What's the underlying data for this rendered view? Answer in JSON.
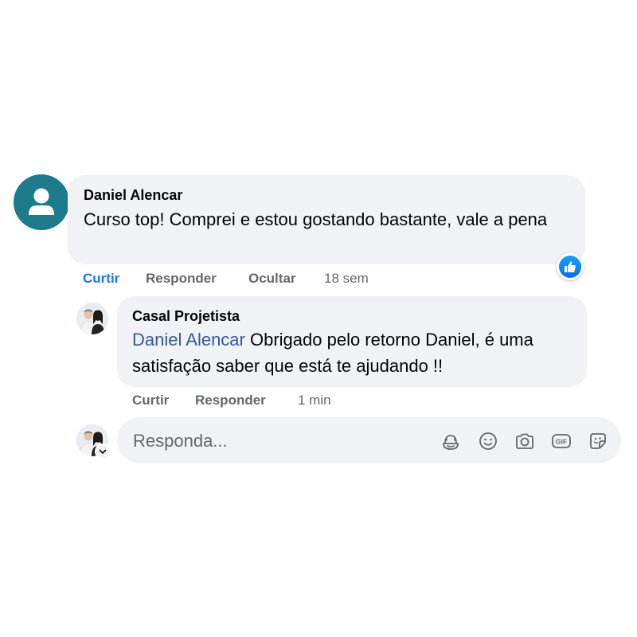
{
  "comments": [
    {
      "author": "Daniel Alencar",
      "text": "Curso top! Comprei e estou gostando bastante, vale a pena",
      "actions": {
        "like": "Curtir",
        "reply": "Responder",
        "hide": "Ocultar",
        "time": "18 sem"
      },
      "reaction": "like-icon"
    },
    {
      "author": "Casal Projetista",
      "mention": "Daniel Alencar",
      "text": " Obrigado pelo retorno Daniel, é uma satisfação saber que está te ajudando !!",
      "actions": {
        "like": "Curtir",
        "reply": "Responder",
        "time": "1 min"
      }
    }
  ],
  "reply_box": {
    "placeholder": "Responda...",
    "tools": [
      "avatar-sticker-icon",
      "emoji-icon",
      "camera-icon",
      "gif-icon",
      "sticker-icon"
    ]
  },
  "colors": {
    "bubble": "#f0f2f5",
    "link": "#385898",
    "active_like": "#1877f2",
    "meta": "#65676b",
    "default_avatar": "#1e7b8c"
  }
}
